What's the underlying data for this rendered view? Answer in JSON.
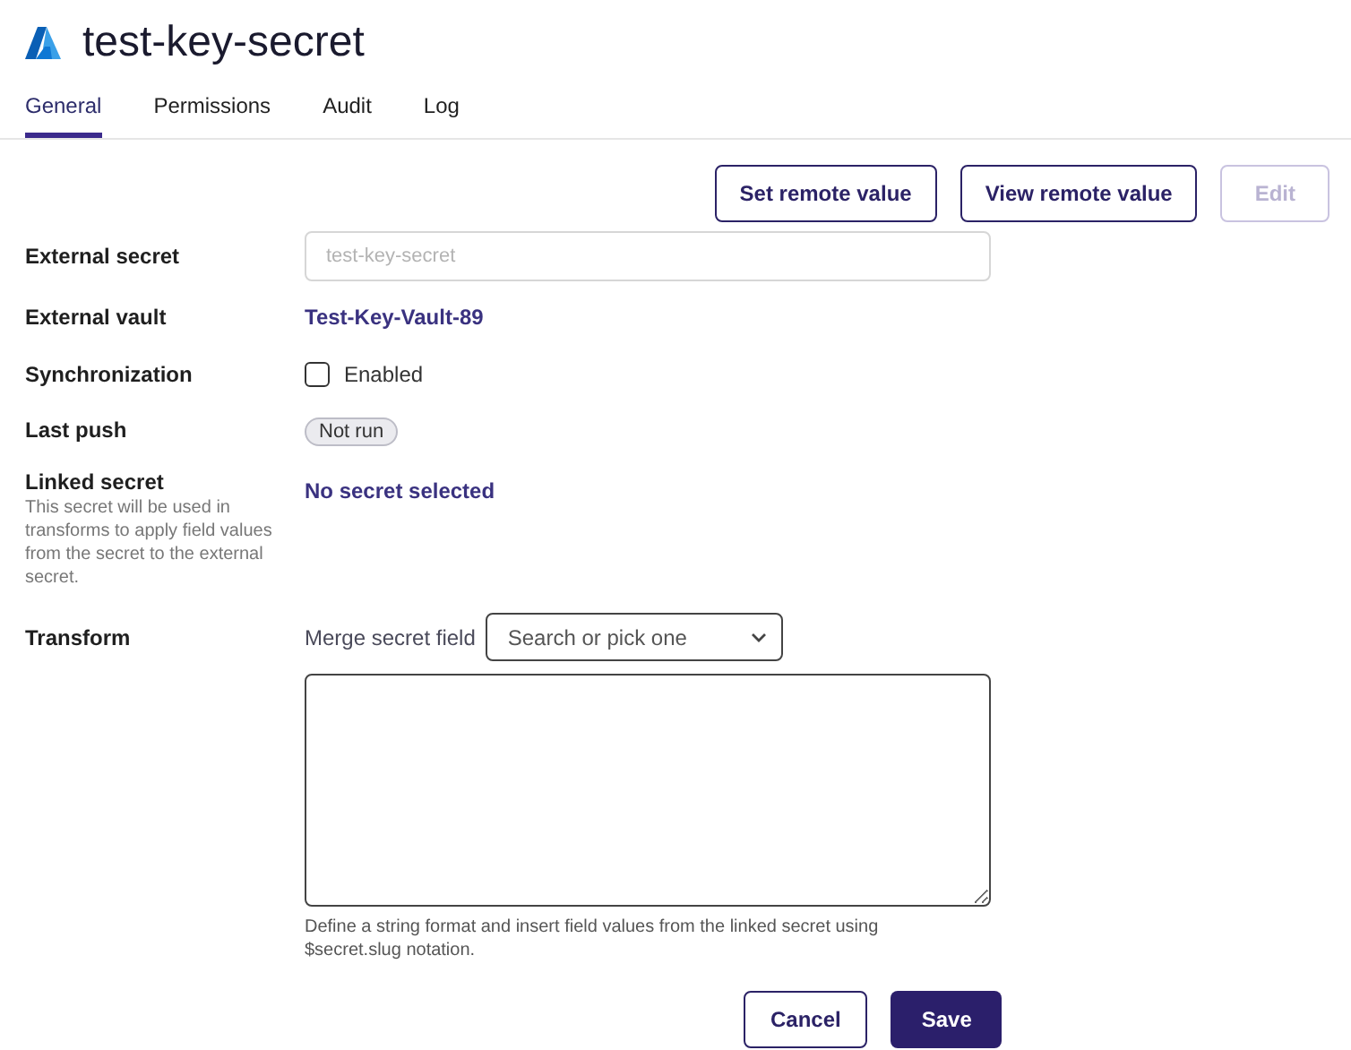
{
  "title": "test-key-secret",
  "tabs": [
    {
      "label": "General",
      "selected": true
    },
    {
      "label": "Permissions",
      "selected": false
    },
    {
      "label": "Audit",
      "selected": false
    },
    {
      "label": "Log",
      "selected": false
    }
  ],
  "actions": [
    {
      "label": "Set remote value",
      "disabled": false
    },
    {
      "label": "View remote value",
      "disabled": false
    },
    {
      "label": "Edit",
      "disabled": true
    }
  ],
  "fields": [
    {
      "kind": "input",
      "label": "External secret",
      "placeholder": "test-key-secret"
    },
    {
      "kind": "link",
      "label": "External vault",
      "value": "Test-Key-Vault-89"
    },
    {
      "kind": "checkbox",
      "label": "Synchronization",
      "option": "Enabled",
      "checked": false
    },
    {
      "kind": "badge",
      "label": "Last push",
      "value": "Not run"
    },
    {
      "kind": "linked",
      "label": "Linked secret",
      "description": "This secret will be used in transforms to apply field values from the secret to the external secret.",
      "value": "No secret selected"
    },
    {
      "kind": "transform",
      "label": "Transform",
      "merge_label": "Merge secret field",
      "select_placeholder": "Search or pick one",
      "help": "Define a string format and insert field values from the linked secret using $secret.slug notation."
    }
  ],
  "footer": [
    {
      "kind": "secondary",
      "label": "Cancel"
    },
    {
      "kind": "primary",
      "label": "Save"
    }
  ]
}
